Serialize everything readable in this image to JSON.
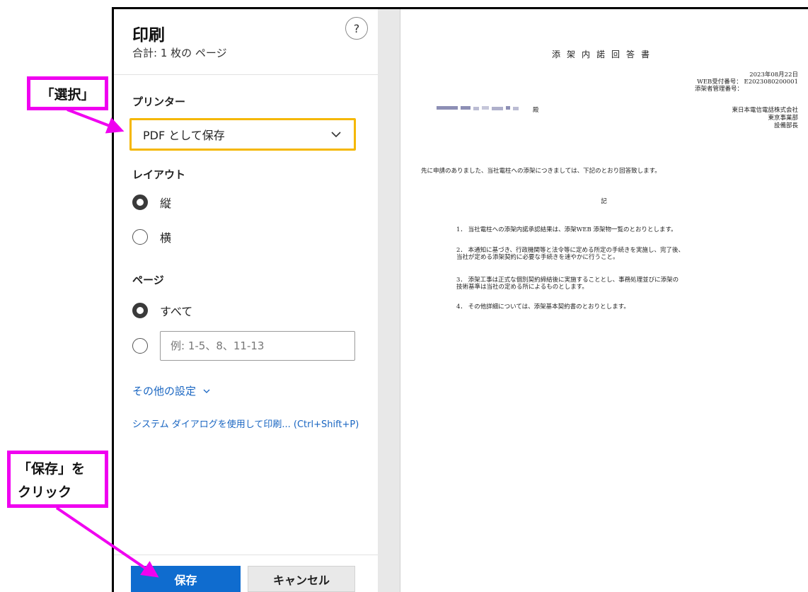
{
  "dialog": {
    "title": "印刷",
    "subtitle": "合計: 1 枚の ページ",
    "help_glyph": "?"
  },
  "printer": {
    "label": "プリンター",
    "selected": "PDF として保存"
  },
  "layout": {
    "label": "レイアウト",
    "options": [
      {
        "label": "縦",
        "checked": true
      },
      {
        "label": "横",
        "checked": false
      }
    ]
  },
  "pages": {
    "label": "ページ",
    "all_label": "すべて",
    "all_checked": true,
    "custom_placeholder": "例: 1-5、8、11-13"
  },
  "links": {
    "more_settings": "その他の設定",
    "system_dialog": "システム ダイアログを使用して印刷... (Ctrl+Shift+P)"
  },
  "buttons": {
    "save": "保存",
    "cancel": "キャンセル"
  },
  "callouts": {
    "select": "「選択」",
    "save_line1": "「保存」を",
    "save_line2": "クリック"
  },
  "document": {
    "title": "添架内諾回答書",
    "date": "2023年08月22日",
    "web_label": "WEB受付番号：",
    "web_number": "E2023080200001",
    "manager_label": "添架者管理番号：",
    "addressee_suffix": "殿",
    "company": "東日本電信電話株式会社",
    "dept": "東京事業部",
    "position": "設備部長",
    "body": "先に申請のありました、当社電柱への添架につきましては、下記のとおり回答致します。",
    "ki": "記",
    "items": [
      "1．  当社電柱への添架内諾承認結果は、添架WEB 添架物一覧のとおりとします。",
      "2．  本通知に基づき、行政機関等と法令等に定める所定の手続きを実施し、完了後、",
      "当社が定める添架契約に必要な手続きを速やかに行うこと。",
      "3．  添架工事は正式な個別契約締結後に実施することとし、事務処理並びに添架の",
      "技術基準は当社の定める所によるものとします。",
      "4．  その他詳細については、添架基本契約書のとおりとします。"
    ]
  },
  "colors": {
    "accent_blue": "#0f6ccf",
    "highlight_yellow": "#f5b700",
    "callout_magenta": "#f000f0"
  }
}
